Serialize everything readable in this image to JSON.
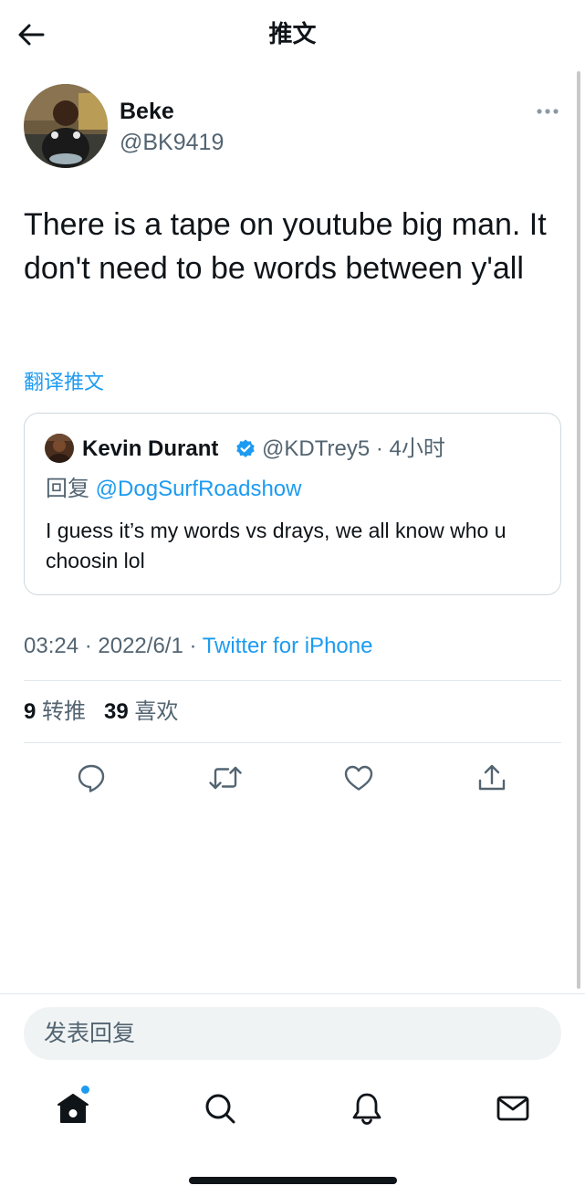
{
  "header": {
    "title": "推文"
  },
  "tweet": {
    "author_name": "Beke",
    "author_handle": "@BK9419",
    "text": "There is a tape on youtube big man. It don't need to be words between y'all",
    "translate_label": "翻译推文",
    "timestamp": "03:24 · 2022/6/1 · ",
    "source": "Twitter for iPhone"
  },
  "quote": {
    "name": "Kevin Durant",
    "handle_time": "@KDTrey5 · 4小时",
    "reply_label": "回复",
    "reply_mention": "@DogSurfRoadshow",
    "text": "I guess it’s my words vs drays, we all know who u choosin lol"
  },
  "stats": {
    "retweets_count": "9",
    "retweets_label": "转推",
    "likes_count": "39",
    "likes_label": "喜欢"
  },
  "reply_box": {
    "placeholder": "发表回复"
  },
  "colors": {
    "accent": "#1d9bf0",
    "text": "#0f1419",
    "secondary": "#536471",
    "border": "#cfd9de"
  },
  "icons": {
    "back": "arrow-left-icon",
    "more": "more-dots-icon",
    "verified": "verified-badge-icon",
    "reply": "reply-bubble-icon",
    "retweet": "retweet-icon",
    "like": "heart-icon",
    "share": "share-upload-icon",
    "home": "home-icon",
    "search": "search-icon",
    "notifications": "bell-icon",
    "messages": "mail-icon"
  }
}
